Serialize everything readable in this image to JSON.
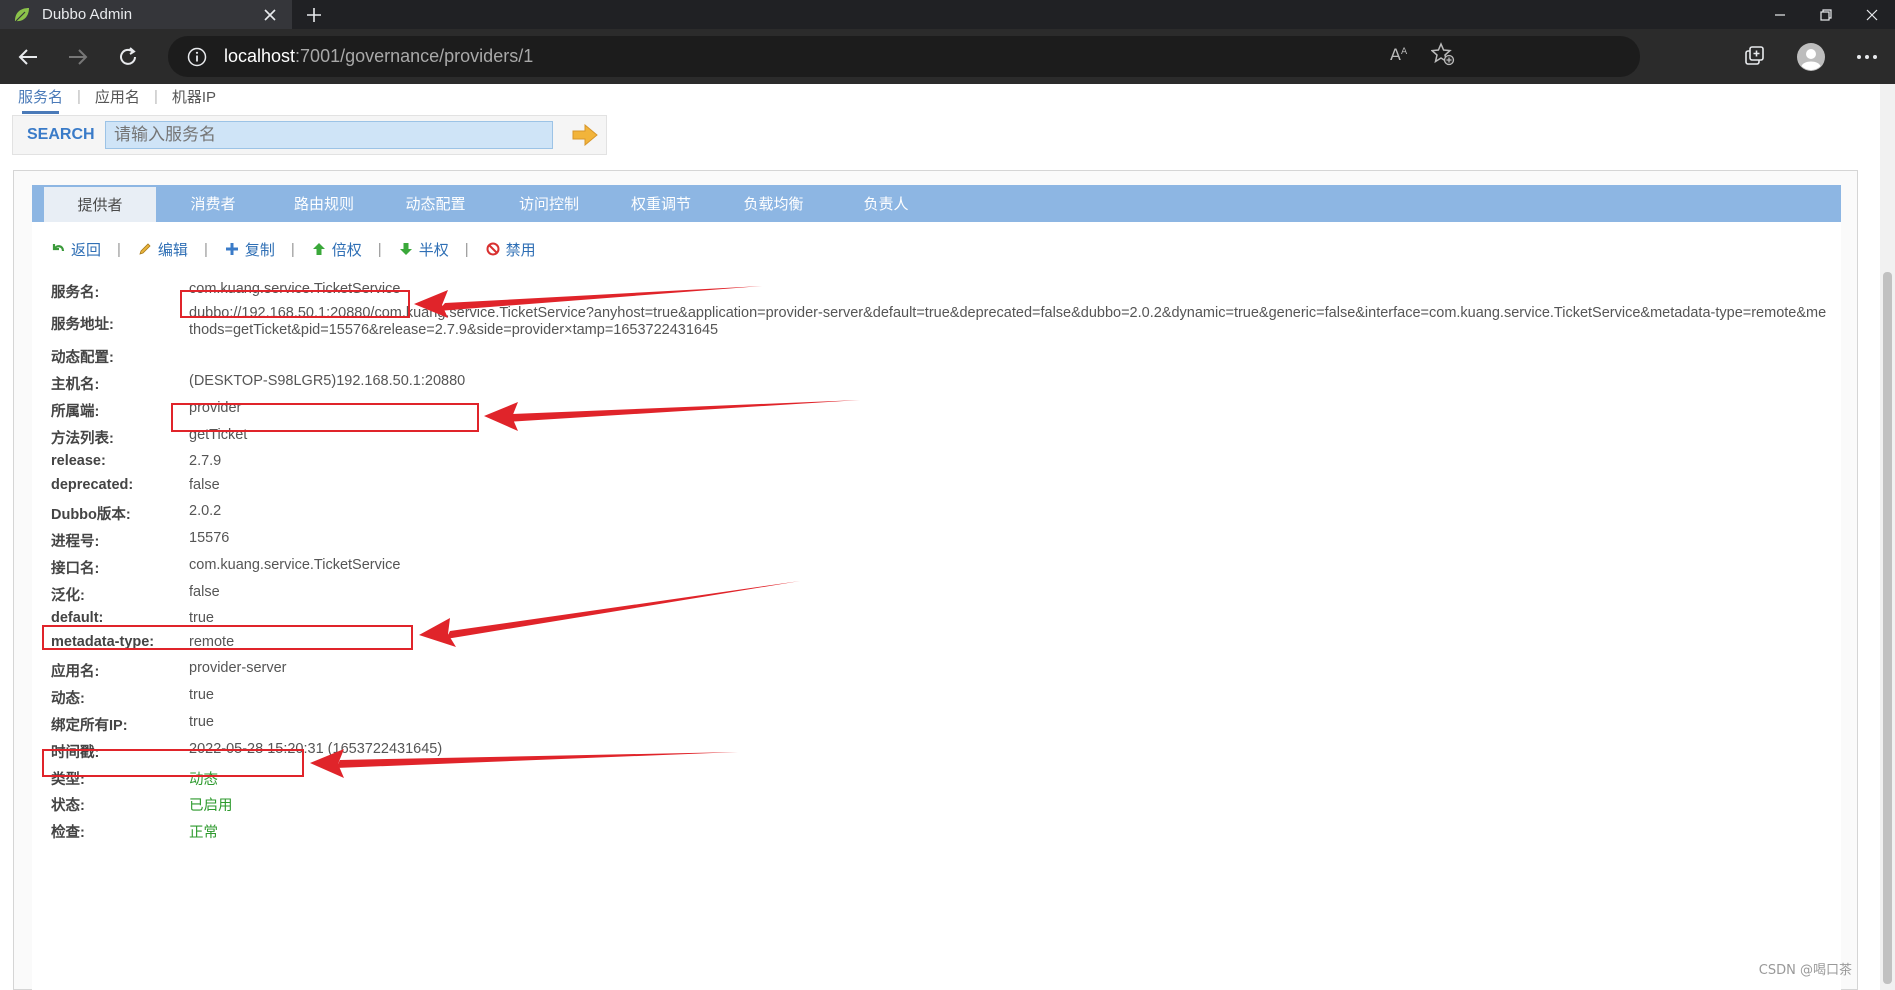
{
  "browser": {
    "tab_title": "Dubbo Admin",
    "url_host": "localhost",
    "url_path": ":7001/governance/providers/1"
  },
  "search": {
    "tabs": [
      "服务名",
      "应用名",
      "机器IP"
    ],
    "label": "SEARCH",
    "placeholder": "请输入服务名"
  },
  "nav": {
    "tabs": [
      "提供者",
      "消费者",
      "路由规则",
      "动态配置",
      "访问控制",
      "权重调节",
      "负载均衡",
      "负责人"
    ]
  },
  "toolbar": {
    "back": "返回",
    "edit": "编辑",
    "copy": "复制",
    "double": "倍权",
    "half": "半权",
    "disable": "禁用"
  },
  "details": [
    {
      "key": "服务名:",
      "value": "com.kuang.service.TicketService"
    },
    {
      "key": "服务地址:",
      "value": "dubbo://192.168.50.1:20880/com.kuang.service.TicketService?anyhost=true&application=provider-server&default=true&deprecated=false&dubbo=2.0.2&dynamic=true&generic=false&interface=com.kuang.service.TicketService&metadata-type=remote&methods=getTicket&pid=15576&release=2.7.9&side=provider×tamp=1653722431645"
    },
    {
      "key": "动态配置:",
      "value": ""
    },
    {
      "key": "主机名:",
      "value": "(DESKTOP-S98LGR5)192.168.50.1:20880"
    },
    {
      "key": "所属端:",
      "value": "provider"
    },
    {
      "key": "方法列表:",
      "value": "getTicket"
    },
    {
      "key": "release:",
      "value": "2.7.9"
    },
    {
      "key": "deprecated:",
      "value": "false"
    },
    {
      "key": "Dubbo版本:",
      "value": "2.0.2"
    },
    {
      "key": "进程号:",
      "value": "15576"
    },
    {
      "key": "接口名:",
      "value": "com.kuang.service.TicketService"
    },
    {
      "key": "泛化:",
      "value": "false"
    },
    {
      "key": "default:",
      "value": "true"
    },
    {
      "key": "metadata-type:",
      "value": "remote"
    },
    {
      "key": "应用名:",
      "value": "provider-server"
    },
    {
      "key": "动态:",
      "value": "true"
    },
    {
      "key": "绑定所有IP:",
      "value": "true"
    },
    {
      "key": "时间戳:",
      "value": "2022-05-28 15:20:31 (1653722431645)"
    },
    {
      "key": "类型:",
      "value": "动态"
    },
    {
      "key": "状态:",
      "value": "已启用"
    },
    {
      "key": "检查:",
      "value": "正常"
    }
  ],
  "watermark": "CSDN @喝口茶",
  "colors": {
    "nav_bar": "#8db6e3",
    "link": "#2f6fb5",
    "annotation": "#e0242a",
    "status_green": "#2e9a2e"
  }
}
